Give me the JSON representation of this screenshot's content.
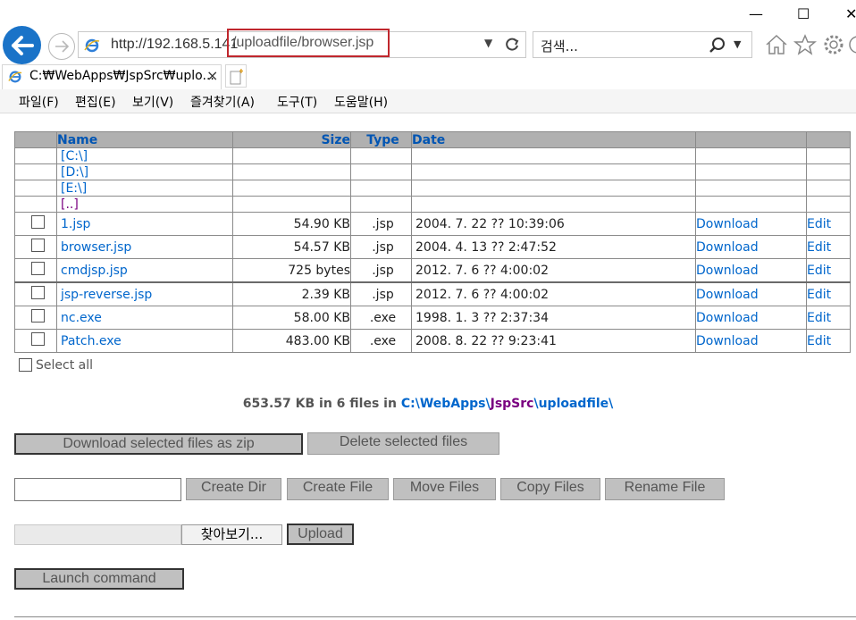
{
  "window": {
    "minimize": "_",
    "maximize": "☐",
    "close": "✕"
  },
  "address": {
    "host": "http://192.168.5.141",
    "path": "/uploadfile/browser.jsp"
  },
  "search": {
    "placeholder": "검색..."
  },
  "tab": {
    "title": "C:₩WebApps₩JspSrc₩uplo...",
    "close": "×"
  },
  "menu": [
    "파일(F)",
    "편집(E)",
    "보기(V)",
    "즐겨찾기(A)",
    "도구(T)",
    "도움말(H)"
  ],
  "table": {
    "headers": {
      "name": "Name",
      "size": "Size",
      "type": "Type",
      "date": "Date"
    },
    "dirs": [
      "[C:\\]",
      "[D:\\]",
      "[E:\\]",
      "[..]"
    ],
    "files": [
      {
        "name": "1.jsp",
        "size": "54.90 KB",
        "type": ".jsp",
        "date": "2004. 7. 22 ?? 10:39:06",
        "download": "Download",
        "edit": "Edit"
      },
      {
        "name": "browser.jsp",
        "size": "54.57 KB",
        "type": ".jsp",
        "date": "2004. 4. 13 ?? 2:47:52",
        "download": "Download",
        "edit": "Edit"
      },
      {
        "name": "cmdjsp.jsp",
        "size": "725 bytes",
        "type": ".jsp",
        "date": "2012. 7. 6 ?? 4:00:02",
        "download": "Download",
        "edit": "Edit"
      },
      {
        "name": "jsp-reverse.jsp",
        "size": "2.39 KB",
        "type": ".jsp",
        "date": "2012. 7. 6 ?? 4:00:02",
        "download": "Download",
        "edit": "Edit"
      },
      {
        "name": "nc.exe",
        "size": "58.00 KB",
        "type": ".exe",
        "date": "1998. 1. 3 ?? 2:37:34",
        "download": "Download",
        "edit": "Edit"
      },
      {
        "name": "Patch.exe",
        "size": "483.00 KB",
        "type": ".exe",
        "date": "2008. 8. 22 ?? 9:23:41",
        "download": "Download",
        "edit": "Edit"
      }
    ]
  },
  "select_all": "Select all",
  "summary": {
    "text": "653.57 KB in 6 files in ",
    "p1": "C:\\WebApps\\",
    "p2": "JspSrc",
    "p3": "\\uploadfile\\"
  },
  "buttons": {
    "download_zip": "Download selected files as zip",
    "delete_selected": "Delete selected files",
    "create_dir": "Create Dir",
    "create_file": "Create File",
    "move_files": "Move Files",
    "copy_files": "Copy Files",
    "rename_file": "Rename File",
    "browse": "찾아보기...",
    "upload": "Upload",
    "launch_command": "Launch command"
  },
  "colors": {
    "accent": "#1a73c8",
    "link": "#0066cc",
    "visited": "#7a0080",
    "highlight": "#c0272d"
  }
}
